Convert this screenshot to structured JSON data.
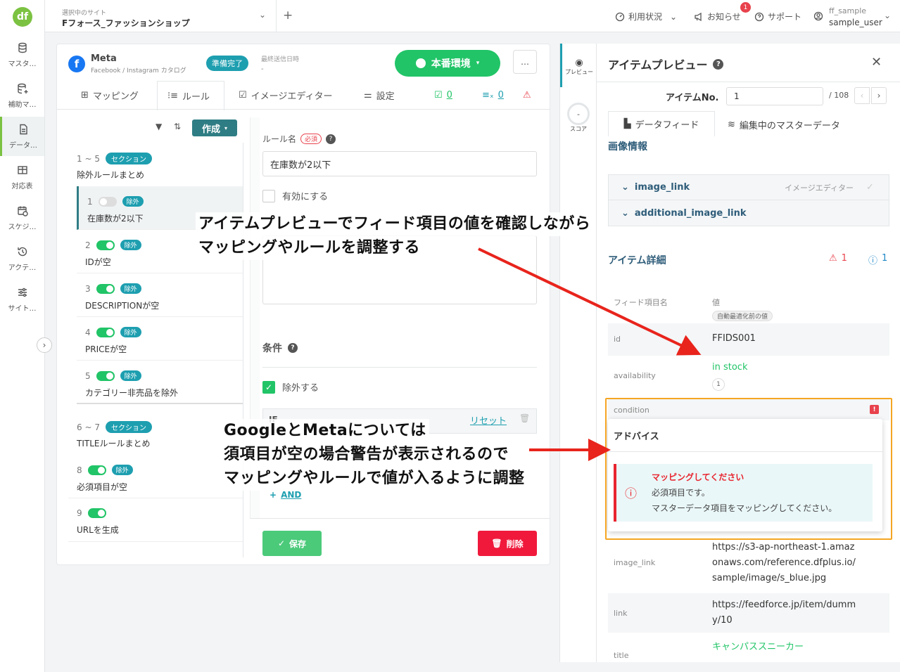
{
  "sidebar": {
    "logo": "df",
    "items": [
      {
        "label": "マスタ…",
        "icon": "database-icon"
      },
      {
        "label": "補助マ…",
        "icon": "database-plus-icon"
      },
      {
        "label": "データ…",
        "icon": "file-icon"
      },
      {
        "label": "対応表",
        "icon": "table-icon"
      },
      {
        "label": "スケジ…",
        "icon": "calendar-icon"
      },
      {
        "label": "アクテ…",
        "icon": "history-icon"
      },
      {
        "label": "サイト…",
        "icon": "sliders-icon"
      }
    ]
  },
  "header": {
    "site_caption": "選択中のサイト",
    "site_name": "Fフォース_ファッションショップ",
    "usage": "利用状況",
    "news": "お知らせ",
    "news_count": "1",
    "support": "サポート",
    "account_top": "ff_sample",
    "account_bottom": "sample_user"
  },
  "channel": {
    "name": "Meta",
    "subtitle": "Facebook / Instagram カタログ",
    "status": "準備完了",
    "last_sent_label": "最終送信日時",
    "last_sent_value": "-",
    "env_button": "本番環境",
    "more": "…"
  },
  "tabs": {
    "mapping": "マッピング",
    "rule": "ルール",
    "image_editor": "イメージエディター",
    "settings": "設定",
    "count_ok": "0",
    "count_x": "0"
  },
  "rules": {
    "create": "作成",
    "sections": [
      {
        "range": "1 ~ 5",
        "tag": "セクション",
        "title": "除外ルールまとめ"
      },
      {
        "range": "6 ~ 7",
        "tag": "セクション",
        "title": "TITLEルールまとめ"
      }
    ],
    "items": [
      {
        "num": "1",
        "tag": "除外",
        "name": "在庫数が2以下"
      },
      {
        "num": "2",
        "tag": "除外",
        "name": "IDが空"
      },
      {
        "num": "3",
        "tag": "除外",
        "name": "DESCRIPTIONが空"
      },
      {
        "num": "4",
        "tag": "除外",
        "name": "PRICEが空"
      },
      {
        "num": "5",
        "tag": "除外",
        "name": "カテゴリー非売品を除外"
      },
      {
        "num": "8",
        "tag": "除外",
        "name": "必須項目が空"
      },
      {
        "num": "9",
        "tag": "",
        "name": "URLを生成"
      }
    ]
  },
  "editor": {
    "rule_name_label": "ルール名",
    "required": "必須",
    "rule_name_value": "在庫数が2以下",
    "enable_label": "有効にする",
    "condition_label": "条件",
    "exclude_label": "除外する",
    "if_label": "IF",
    "reset": "リセット",
    "and": "AND",
    "save": "保存",
    "delete": "削除"
  },
  "preview": {
    "title": "アイテムプレビュー",
    "side_preview": "プレビュー",
    "side_score": "スコア",
    "item_no_label": "アイテムNo.",
    "item_no_value": "1",
    "item_total": "/ 108",
    "tab_feed": "データフィード",
    "tab_master": "編集中のマスターデータ",
    "image_info": "画像情報",
    "image_link": "image_link",
    "image_editor": "イメージエディター",
    "additional_image_link": "additional_image_link",
    "item_detail": "アイテム詳細",
    "error_count": "1",
    "info_count": "1",
    "col_field": "フィード項目名",
    "col_value": "値",
    "col_value_tag": "自動最適化前の値",
    "fields": [
      {
        "key": "id",
        "value": "FFIDS001"
      },
      {
        "key": "availability",
        "value": "in stock",
        "sub": "1"
      },
      {
        "key": "condition",
        "value": ""
      },
      {
        "key": "image_link",
        "value": "https://s3-ap-northeast-1.amazonaws.com/reference.dfplus.io/sample/image/s_blue.jpg"
      },
      {
        "key": "link",
        "value": "https://feedforce.jp/item/dummy/10"
      },
      {
        "key": "title",
        "value": "キャンパススニーカー"
      }
    ],
    "advice": {
      "title": "アドバイス",
      "heading": "マッピングしてください",
      "line1": "必須項目です。",
      "line2": "マスターデータ項目をマッピングしてください。"
    }
  },
  "annotations": {
    "top_line1": "アイテムプレビューでフィード項目の値を確認しながら",
    "top_line2": "マッピングやルールを調整する",
    "bottom_line1": "GoogleとMetaについては",
    "bottom_line2": "須項目が空の場合警告が表示されるので",
    "bottom_line3": "マッピングやルールで値が入るように調整"
  },
  "colors": {
    "accent_green": "#21c467",
    "teal": "#1e9fb0",
    "error_red": "#e8424c",
    "highlight_orange": "#f5a623",
    "arrow_red": "#e8241c"
  }
}
